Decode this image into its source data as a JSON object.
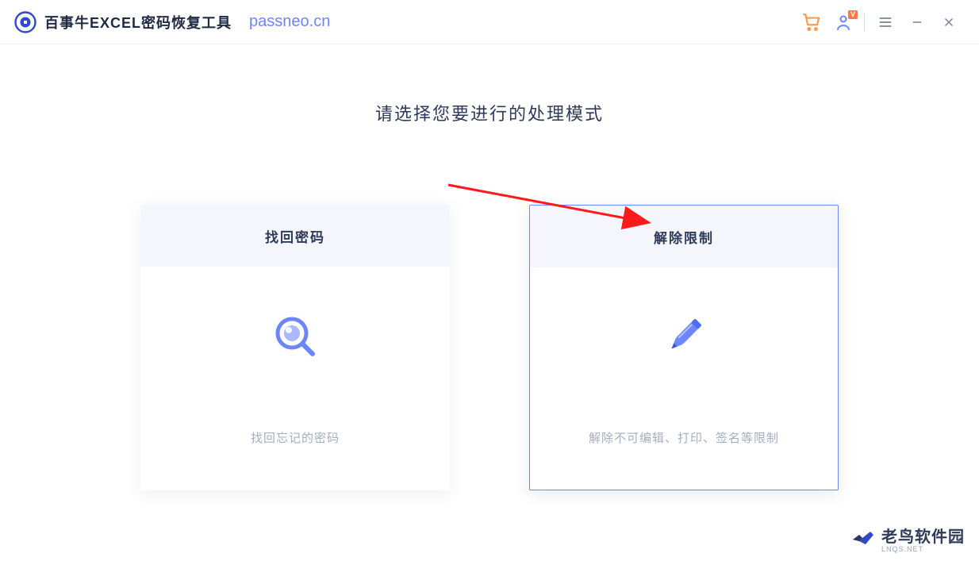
{
  "header": {
    "app_title": "百事牛EXCEL密码恢复工具",
    "domain": "passneo.cn",
    "vip_tag": "V"
  },
  "main": {
    "title": "请选择您要进行的处理模式"
  },
  "cards": [
    {
      "title": "找回密码",
      "desc": "找回忘记的密码"
    },
    {
      "title": "解除限制",
      "desc": "解除不可编辑、打印、签名等限制"
    }
  ],
  "watermark": {
    "main": "老鸟软件园",
    "sub": "LNQS.NET"
  }
}
